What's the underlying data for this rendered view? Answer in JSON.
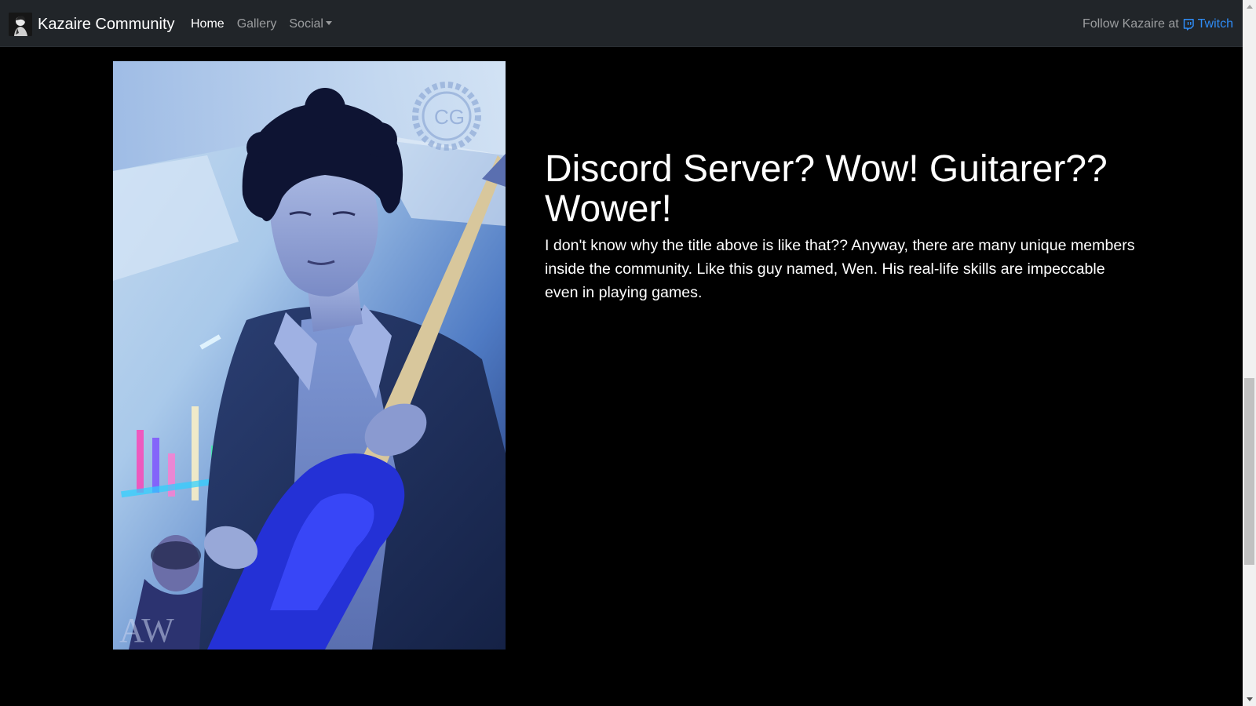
{
  "navbar": {
    "brand": "Kazaire Community",
    "links": [
      {
        "label": "Home"
      },
      {
        "label": "Gallery"
      },
      {
        "label": "Social"
      }
    ],
    "follow_prefix": "Follow Kazaire at",
    "twitch_label": "Twitch"
  },
  "hero": {
    "title": "Discord Server? Wow! Guitarer?? Wower!",
    "body": "I don't know why the title above is like that?? Anyway, there are many unique members inside the community. Like this guy named, Wen. His real-life skills are impeccable even in playing games."
  },
  "colors": {
    "navbar_bg": "#212529",
    "page_bg": "#000000",
    "link_accent": "#2f8cf6"
  },
  "icons": [
    "brand-logo",
    "chevron-down-icon",
    "twitch-icon"
  ]
}
